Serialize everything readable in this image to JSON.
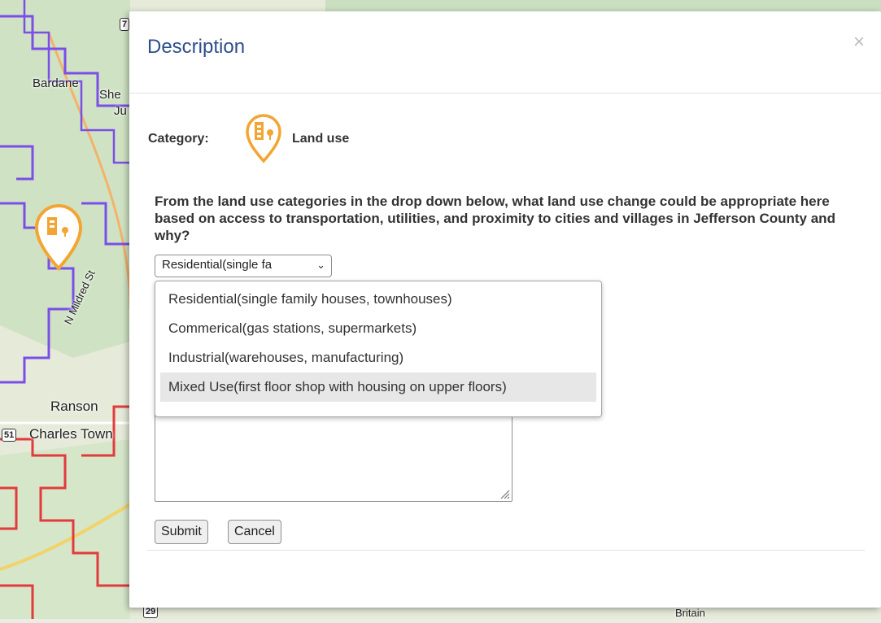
{
  "map": {
    "labels": [
      "Bardane",
      "She",
      "Ju",
      "N Mildred St",
      "Ranson",
      "Charles Town",
      "Britain"
    ],
    "shields": [
      "51",
      "29",
      "7"
    ]
  },
  "modal": {
    "title": "Description",
    "close_icon": "×",
    "category_label": "Category:",
    "category_value": "Land use",
    "category_icon": "land-use-pin-icon",
    "question": "From the land use categories in the drop down below, what land use change could be appropriate here based on access to transportation, utilities, and proximity to cities and villages in Jefferson County and why?",
    "select": {
      "selected": "Residential(single fa",
      "options": [
        "Residential(single family houses, townhouses)",
        "Commerical(gas stations, supermarkets)",
        "Industrial(warehouses, manufacturing)",
        "Mixed Use(first floor shop with housing on upper floors)"
      ],
      "highlighted_index": 3
    },
    "submit_label": "Submit",
    "cancel_label": "Cancel"
  },
  "colors": {
    "accent_title": "#2d4f8c",
    "pin_orange": "#f3a533",
    "boundary_purple": "#7b4ee8",
    "boundary_red": "#e23b3b"
  }
}
